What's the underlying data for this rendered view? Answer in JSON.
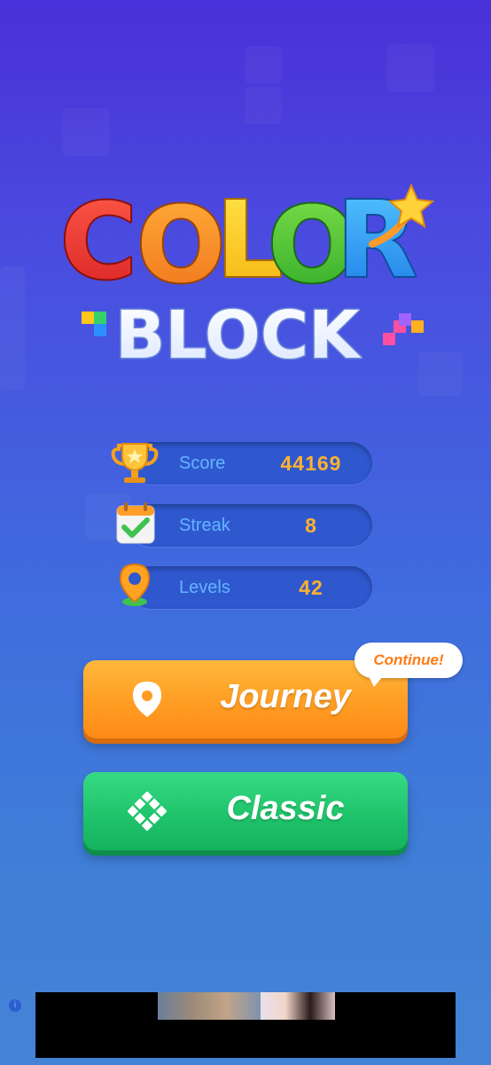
{
  "logo": {
    "word1_letters": [
      "C",
      "O",
      "L",
      "O",
      "R"
    ],
    "word2": "BLOCK"
  },
  "stats": [
    {
      "label": "Score",
      "value": "44169",
      "icon": "trophy-icon"
    },
    {
      "label": "Streak",
      "value": "8",
      "icon": "calendar-check-icon"
    },
    {
      "label": "Levels",
      "value": "42",
      "icon": "map-pin-icon"
    }
  ],
  "buttons": {
    "journey": {
      "label": "Journey",
      "icon": "location-pin-icon",
      "badge": "Continue!"
    },
    "classic": {
      "label": "Classic",
      "icon": "grid-blocks-icon"
    }
  },
  "ad": {
    "info_icon": "i"
  },
  "colors": {
    "background_top": "#4a30d8",
    "background_bottom": "#4583d6",
    "stat_label": "#64b4ff",
    "stat_value": "#ffb22e",
    "journey": "#ff9d23",
    "classic": "#1fc46b",
    "badge_text": "#ff7a14"
  }
}
